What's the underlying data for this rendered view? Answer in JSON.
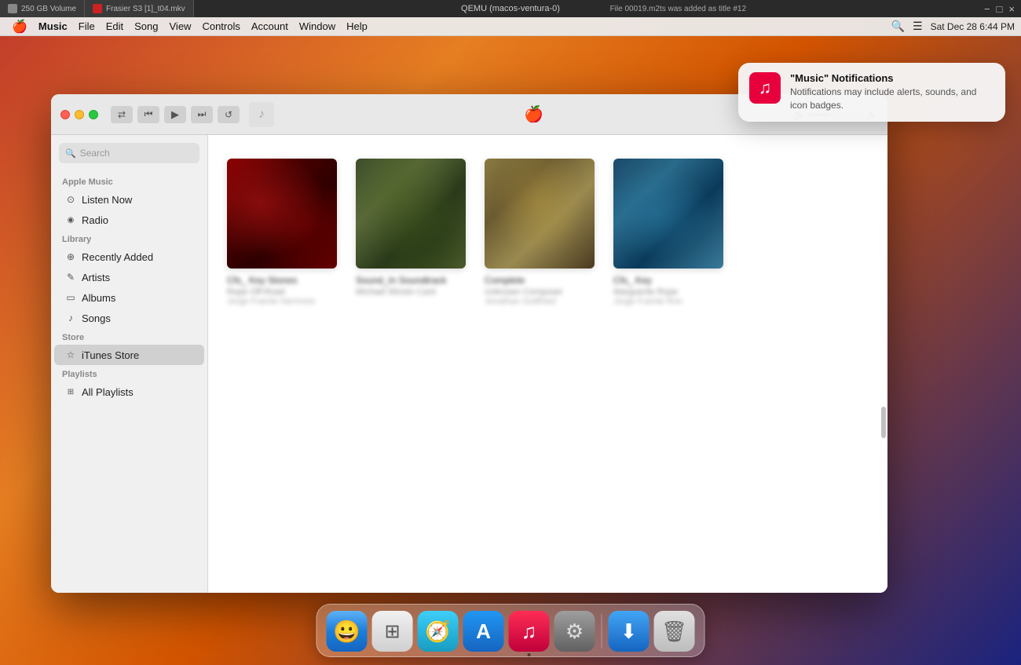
{
  "topStrip": {
    "tab1": "250 GB Volume",
    "tab2": "Frasier S3 [1]_t04.mkv",
    "tab3": "File 00019.m2ts was added as title #12",
    "title": "QEMU (macos-ventura-0)",
    "btnMin": "−",
    "btnMax": "□",
    "btnClose": "×"
  },
  "macMenu": {
    "apple": "",
    "items": [
      "Music",
      "File",
      "Edit",
      "Song",
      "View",
      "Controls",
      "Account",
      "Window",
      "Help"
    ],
    "rightDate": "Sat Dec 28",
    "rightTime": "6:44 PM"
  },
  "window": {
    "titlebar": {
      "controls": {
        "shuffle": "⇄",
        "prev": "⏮",
        "play": "▶",
        "next": "⏭",
        "repeat": "↺"
      },
      "musicNote": "♪",
      "appleLogo": ""
    }
  },
  "sidebar": {
    "search": {
      "placeholder": "Search",
      "icon": "🔍"
    },
    "sections": {
      "appleMusic": {
        "label": "Apple Music",
        "items": [
          {
            "id": "listen-now",
            "icon": "⊙",
            "label": "Listen Now"
          },
          {
            "id": "radio",
            "icon": "◉",
            "label": "Radio"
          }
        ]
      },
      "library": {
        "label": "Library",
        "items": [
          {
            "id": "recently-added",
            "icon": "⊕",
            "label": "Recently Added"
          },
          {
            "id": "artists",
            "icon": "✎",
            "label": "Artists"
          },
          {
            "id": "albums",
            "icon": "▭",
            "label": "Albums"
          },
          {
            "id": "songs",
            "icon": "♪",
            "label": "Songs"
          }
        ]
      },
      "store": {
        "label": "Store",
        "items": [
          {
            "id": "itunes-store",
            "icon": "☆",
            "label": "iTunes Store",
            "active": true
          }
        ]
      },
      "playlists": {
        "label": "Playlists",
        "items": [
          {
            "id": "all-playlists",
            "icon": "⊞",
            "label": "All Playlists"
          }
        ]
      }
    }
  },
  "albums": [
    {
      "id": 1,
      "title": "Cfs_ Key Stones",
      "artist": "Rope Off-Road",
      "extra": "Jorge Fuente Hermoso",
      "artClass": "album-art-1"
    },
    {
      "id": 2,
      "title": "Sound_In Soundtrack",
      "artist": "Michael Winstn Card",
      "extra": "",
      "artClass": "album-art-2"
    },
    {
      "id": 3,
      "title": "Complete",
      "artist": "Unknown Composer",
      "extra": "Jonathan Gottfried",
      "artClass": "album-art-3"
    },
    {
      "id": 4,
      "title": "Cfs_ Key",
      "artist": "Marguerite Rope",
      "extra": "Jorge Fuente Ron",
      "artClass": "album-art-4"
    }
  ],
  "notification": {
    "title": "\"Music\" Notifications",
    "body": "Notifications may include alerts, sounds, and icon badges.",
    "icon": "♫"
  },
  "dock": {
    "items": [
      {
        "id": "finder",
        "icon": "🔵",
        "label": "Finder",
        "cssClass": "dock-finder",
        "hasDot": false
      },
      {
        "id": "launchpad",
        "icon": "⊞",
        "label": "Launchpad",
        "cssClass": "dock-launchpad",
        "hasDot": false
      },
      {
        "id": "safari",
        "icon": "🧭",
        "label": "Safari",
        "cssClass": "dock-safari",
        "hasDot": false
      },
      {
        "id": "appstore",
        "icon": "A",
        "label": "App Store",
        "cssClass": "dock-appstore",
        "hasDot": false
      },
      {
        "id": "music",
        "icon": "♫",
        "label": "Music",
        "cssClass": "dock-music",
        "hasDot": true
      },
      {
        "id": "settings",
        "icon": "⚙",
        "label": "System Settings",
        "cssClass": "dock-settings",
        "hasDot": false
      },
      {
        "id": "downloads",
        "icon": "⬇",
        "label": "Downloads",
        "cssClass": "dock-downloads",
        "hasDot": false
      },
      {
        "id": "trash",
        "icon": "🗑",
        "label": "Trash",
        "cssClass": "dock-trash",
        "hasDot": false
      }
    ]
  }
}
